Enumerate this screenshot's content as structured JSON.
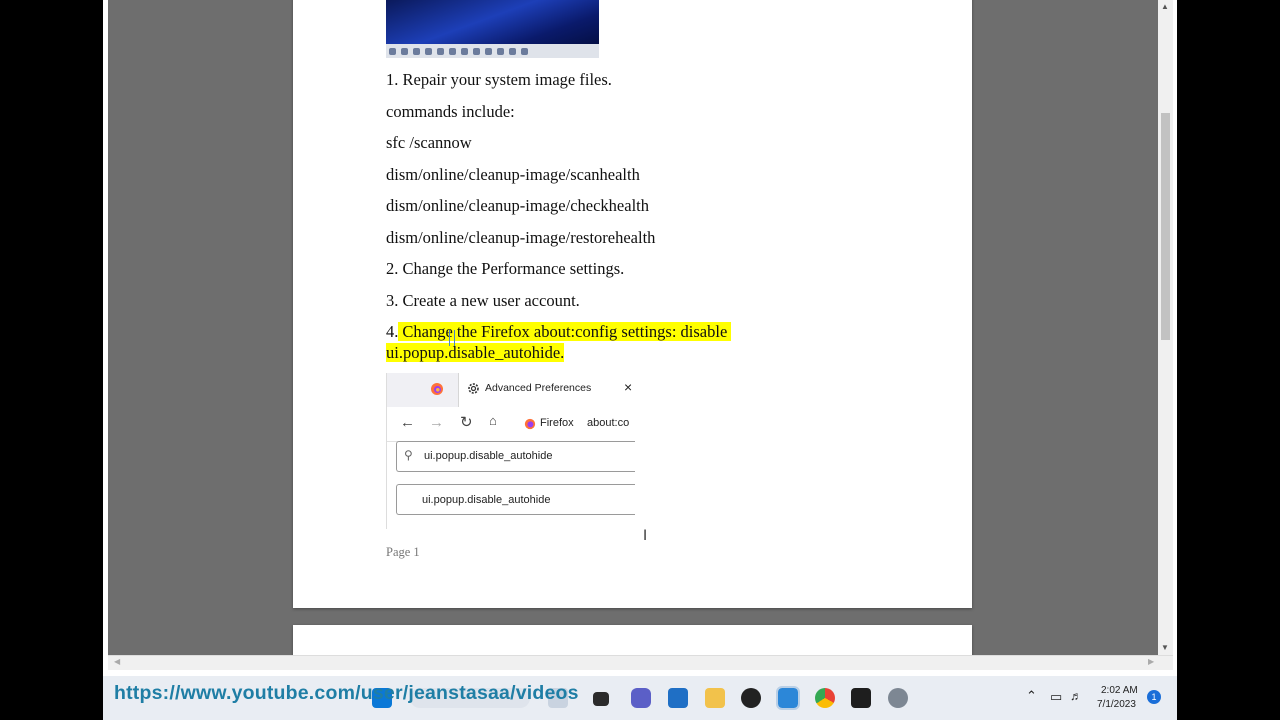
{
  "document": {
    "lines": [
      "1. Repair your system image files.",
      "commands include:",
      "sfc /scannow",
      "dism/online/cleanup-image/scanhealth",
      "dism/online/cleanup-image/checkhealth",
      "dism/online/cleanup-image/restorehealth",
      "2. Change the Performance settings.",
      "3. Create a new user account."
    ],
    "step4_number": "4.",
    "step4_line1": "Change the Firefox about:config settings: disable",
    "step4_line2": "ui.popup.disable_autohide.",
    "page_label": "Page 1"
  },
  "embedded_screenshot": {
    "tab_title": "Advanced Preferences",
    "tab_close": "×",
    "browser_label": "Firefox",
    "url_text": "about:co",
    "search_value": "ui.popup.disable_autohide",
    "result_pref": "ui.popup.disable_autohide"
  },
  "overlay_url": "https://www.youtube.com/user/jeanstasaa/videos",
  "tray": {
    "time": "2:02 AM",
    "date": "7/1/2023",
    "notification_count": "1"
  },
  "colors": {
    "highlight": "#ffff00",
    "overlay_text": "#1f7ea5",
    "viewport_bg": "#6e6e6e"
  }
}
